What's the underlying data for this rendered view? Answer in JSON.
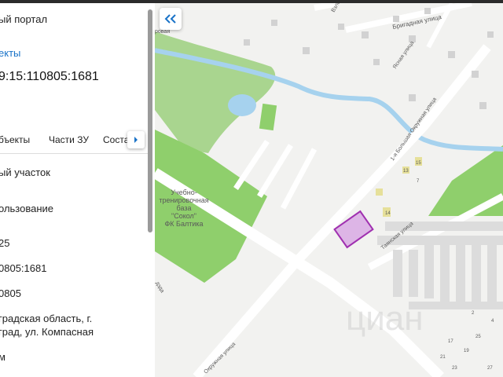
{
  "panel": {
    "portal_title": "ый портал",
    "objects_link": "екты",
    "cadastral_number": "9:15:110805:1681",
    "tabs": [
      {
        "label": "бъекты"
      },
      {
        "label": "Части ЗУ"
      },
      {
        "label": "Соста"
      }
    ],
    "fields": {
      "type": "ый участок",
      "usage": "ользование",
      "value1": "25",
      "cadastral_short": "0805:1681",
      "quarter": "0805",
      "address_line1": "градская область, г.",
      "address_line2": "град, ул. Компасная",
      "area": "м"
    }
  },
  "map": {
    "base_label": [
      "Учебно-",
      "тренировочная",
      "база",
      "\"Сокол\"",
      "ФК Балтика"
    ],
    "streets": {
      "brigadnaya": "Бригадная улица",
      "yasnaya": "Ясная улица",
      "bolshaya_okruzhnaya": "1-я Большая Окружная улица",
      "tayanskaya": "Таянская улица",
      "okruzhnaya_bottom": "Окружная улица",
      "vzl": "Взлё",
      "ovaya": "ровая",
      "dzda": "дзда"
    },
    "numbers": [
      "15",
      "13",
      "7",
      "14",
      "17",
      "19",
      "21",
      "23",
      "25",
      "27",
      "2",
      "4"
    ],
    "watermark": "циан",
    "accent": "#a030b0",
    "green": "#8fcf6c"
  }
}
